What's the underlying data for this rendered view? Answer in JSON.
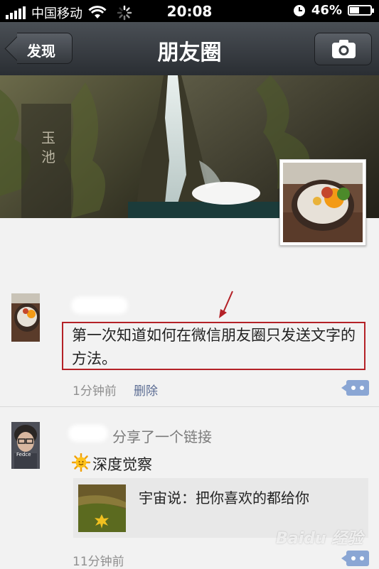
{
  "status_bar": {
    "carrier": "中国移动",
    "time": "20:08",
    "battery": "46%",
    "battery_level": 0.46
  },
  "nav": {
    "back_label": "发现",
    "title": "朋友圈"
  },
  "posts": [
    {
      "text": "第一次知道如何在微信朋友圈只发送文字的方法。",
      "time": "1分钟前",
      "delete_label": "删除"
    },
    {
      "share_label": "分享了一个链接",
      "text": "深度觉察",
      "link_title": "宇宙说：把你喜欢的都给你",
      "time": "11分钟前"
    }
  ],
  "avatar_caption": "Fedce",
  "cover_inscription": "玉池",
  "watermark": "Baidu 经验",
  "colors": {
    "accent_link": "#5b6c93",
    "highlight_box": "#b42127",
    "comment_button": "#8aa6d4"
  }
}
